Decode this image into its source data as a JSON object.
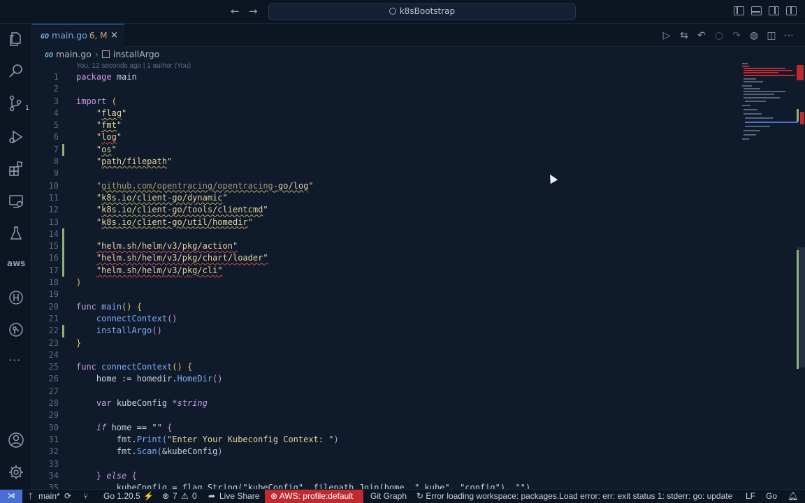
{
  "titlebar": {
    "back_label": "←",
    "forward_label": "→",
    "search_text": "k8sBootstrap"
  },
  "activity": {
    "scm_badge": "1",
    "aws_label": "aws",
    "more_label": "···"
  },
  "tab": {
    "filename": "main.go",
    "status": "6, M",
    "go_icon": "GO",
    "close": "×"
  },
  "breadcrumb": {
    "file": "main.go",
    "separator": "›",
    "symbol": "installArgo"
  },
  "blame": "You, 12 seconds ago | 1 author (You)",
  "code_lines": [
    {
      "n": "1"
    },
    {
      "n": "2"
    },
    {
      "n": "3"
    },
    {
      "n": "4"
    },
    {
      "n": "5"
    },
    {
      "n": "6"
    },
    {
      "n": "7"
    },
    {
      "n": "8"
    },
    {
      "n": "9"
    },
    {
      "n": "10"
    },
    {
      "n": "11"
    },
    {
      "n": "12"
    },
    {
      "n": "13"
    },
    {
      "n": "14"
    },
    {
      "n": "15"
    },
    {
      "n": "16"
    },
    {
      "n": "17"
    },
    {
      "n": "18"
    },
    {
      "n": "19"
    },
    {
      "n": "20"
    },
    {
      "n": "21"
    },
    {
      "n": "22"
    },
    {
      "n": "23"
    },
    {
      "n": "24"
    },
    {
      "n": "25"
    },
    {
      "n": "26"
    },
    {
      "n": "27"
    },
    {
      "n": "28"
    },
    {
      "n": "29"
    },
    {
      "n": "30"
    },
    {
      "n": "31"
    },
    {
      "n": "32"
    },
    {
      "n": "33"
    },
    {
      "n": "34"
    },
    {
      "n": "35"
    }
  ],
  "code": {
    "l1_kw": "package",
    "l1_name": " main",
    "l3_kw": "import",
    "l3_paren": " (",
    "imp_flag": "flag",
    "imp_fmt": "fmt",
    "imp_log": "log",
    "imp_os": "os",
    "imp_path": "path/filepath",
    "imp_ot": "github.com/opentracing/opentracing",
    "imp_ot2": "-go/log",
    "imp_dyn": "k8s.io/client-go/dynamic",
    "imp_cc": "k8s.io/client-go/tools/clientcmd",
    "imp_hd": "k8s.io/client-go/util/homedir",
    "imp_act": "helm.sh/helm/v3/pkg/action",
    "imp_ldr": "helm.sh/helm/v3/pkg/chart/loader",
    "imp_cli": "helm.sh/helm/v3/pkg/cli",
    "close_paren": ")",
    "func_kw": "func",
    "main_name": " main",
    "connect_ctx": "connectContext",
    "install_argo": "installArgo",
    "home_decl": "home := homedir.",
    "home_dir": "HomeDir",
    "var_kw": "var",
    "kubeconfig": " kubeConfig ",
    "string_ty": "*string",
    "if_kw": "if",
    "home_cmp": " home == \"\" ",
    "fmt_dot": "fmt.",
    "print_fn": "Print",
    "print_str": "\"Enter Your Kubeconfig Context: \"",
    "scan_fn": "Scan",
    "scan_arg": "&kubeConfig",
    "else_kw": "else",
    "l35_text": "kubeConfig = flag.String(\"kubeConfig\", filepath.Join(home, \".kube\", \"config\"), \"\")"
  },
  "status": {
    "remote": "⋊",
    "branch": "main*",
    "go_version": "Go 1.20.5",
    "errors": "7",
    "warnings": "0",
    "live_share": "Live Share",
    "aws_profile": "AWS: profile:default",
    "git_graph": "Git Graph",
    "error_msg": "Error loading workspace: packages.Load error: err: exit status 1: stderr: go: updates to go.mod needed",
    "eol": "LF",
    "language": "Go"
  }
}
